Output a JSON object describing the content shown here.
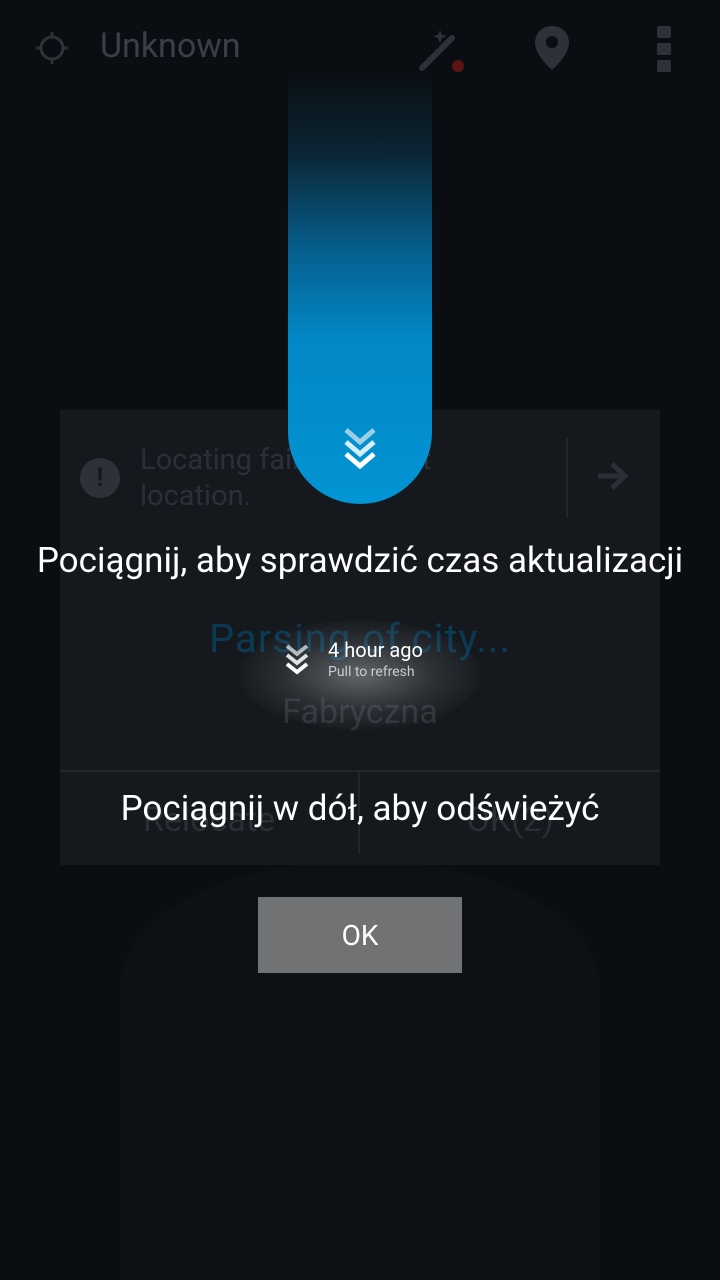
{
  "app_bar": {
    "title": "Unknown",
    "icons": [
      "locate-icon",
      "magic-wand-icon",
      "location-pin-icon",
      "overflow-menu-icon"
    ]
  },
  "background_dialog": {
    "message": "Locating failed, try last location.",
    "city_text": "Parsing of city...",
    "district": "Fabryczna",
    "relocate_label": "Relocate",
    "ok_label": "OK(2)"
  },
  "tutorial": {
    "title": "Pociągnij, aby sprawdzić czas aktualizacji",
    "subtitle": "Pociągnij w dół, aby odświeżyć",
    "ok_button": "OK"
  },
  "refresh_status": {
    "updated": "4 hour ago",
    "hint": "Pull to refresh"
  },
  "colors": {
    "accent_blue": "#0294d4",
    "button_gray": "#707274",
    "background": "#0a0e12"
  }
}
